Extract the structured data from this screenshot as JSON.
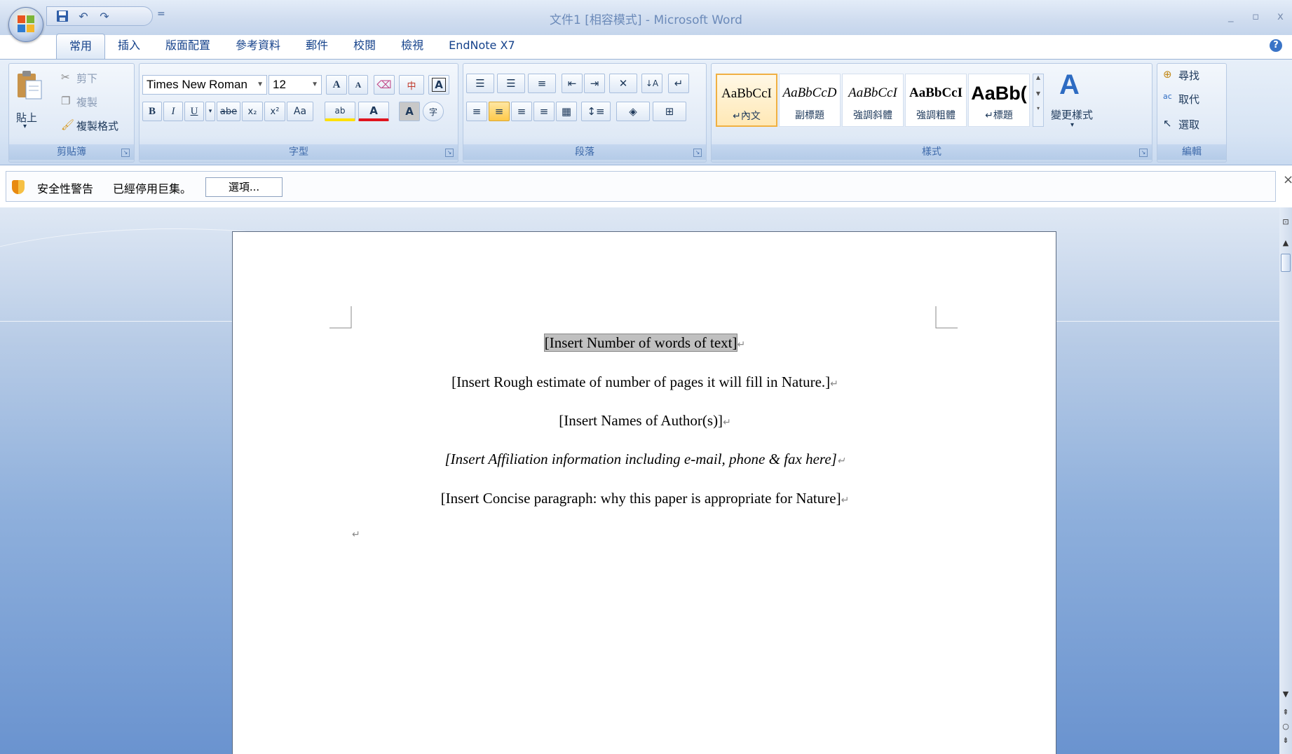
{
  "window": {
    "title": "文件1 [相容模式] - Microsoft Word",
    "controls": {
      "minimize": "_",
      "restore": "▫",
      "close": "x"
    }
  },
  "quick_access": {
    "save_icon": "save-icon",
    "undo_icon": "undo-icon",
    "redo_icon": "redo-icon",
    "more": "="
  },
  "tabs": [
    {
      "label": "常用",
      "active": true
    },
    {
      "label": "插入"
    },
    {
      "label": "版面配置"
    },
    {
      "label": "參考資料"
    },
    {
      "label": "郵件"
    },
    {
      "label": "校閱"
    },
    {
      "label": "檢視"
    },
    {
      "label": "EndNote X7"
    }
  ],
  "ribbon": {
    "clipboard": {
      "label": "剪貼簿",
      "paste": "貼上",
      "cut": "剪下",
      "copy": "複製",
      "format_painter": "複製格式"
    },
    "font": {
      "label": "字型",
      "font_name": "Times New Roman",
      "font_size": "12",
      "grow": "A",
      "shrink": "A",
      "bold": "B",
      "italic": "I",
      "underline": "U",
      "strike": "abe",
      "subscript": "x₂",
      "superscript": "x²",
      "change_case": "Aa",
      "highlight": "ab",
      "font_color": "A",
      "char_shading": "A",
      "enclose": "字"
    },
    "paragraph": {
      "label": "段落"
    },
    "styles": {
      "label": "樣式",
      "items": [
        {
          "sample": "AaBbCcI",
          "name": "內文",
          "mark": "↵",
          "active": true
        },
        {
          "sample": "AaBbCcD",
          "name": "副標題",
          "mark": ""
        },
        {
          "sample": "AaBbCcI",
          "name": "強調斜體",
          "mark": ""
        },
        {
          "sample": "AaBbCcI",
          "name": "強調粗體",
          "mark": ""
        },
        {
          "sample": "AaBb(",
          "name": "標題",
          "mark": "↵"
        }
      ],
      "change_styles": "變更樣式"
    },
    "editing": {
      "label": "編輯",
      "find": "尋找",
      "replace": "取代",
      "select": "選取"
    }
  },
  "message_bar": {
    "title": "安全性警告",
    "text": "已經停用巨集。",
    "options_button": "選項..."
  },
  "document": {
    "lines": [
      {
        "text": "[Insert Number of words of text]",
        "highlighted": true,
        "italic": false
      },
      {
        "text": "[Insert Rough estimate of number of pages it will fill in Nature.]",
        "highlighted": false,
        "italic": false
      },
      {
        "text": "[Insert Names of Author(s)]",
        "highlighted": false,
        "italic": false
      },
      {
        "text": "[Insert Affiliation information including e-mail, phone & fax here]",
        "highlighted": false,
        "italic": true
      },
      {
        "text": "[Insert Concise paragraph: why this paper is appropriate for Nature]",
        "highlighted": false,
        "italic": false
      }
    ],
    "paragraph_mark": "↵"
  },
  "colors": {
    "accent": "#15428b",
    "ribbon_bg": "#d7e4f4",
    "workspace": "#6a93cf",
    "active_style": "#f0b042"
  }
}
